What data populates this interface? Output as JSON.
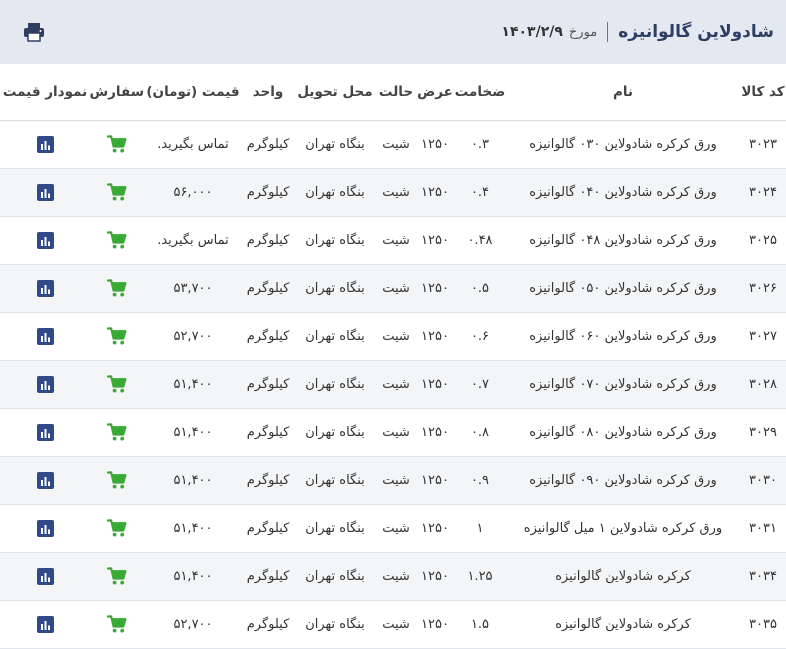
{
  "header": {
    "title": "شادولاین گالوانیزه",
    "date_label": "مورخ",
    "date_value": "۱۴۰۳/۲/۹",
    "print_icon": "printer-icon"
  },
  "colors": {
    "header_bg": "#e4e8f1",
    "title": "#2f3f63",
    "chart_button": "#2f4a86",
    "cart_icon": "#3aaa35"
  },
  "columns": {
    "code": "کد کالا",
    "name": "نام",
    "thickness": "ضخامت",
    "width": "عرض",
    "state": "حالت",
    "delivery": "محل تحویل",
    "unit": "واحد",
    "price": "قیمت (تومان)",
    "order": "سفارش",
    "chart": "نمودار قیمت"
  },
  "rows": [
    {
      "code": "۳۰۲۳",
      "name": "ورق کرکره شادولاین ۰۳۰ گالوانیزه",
      "thickness": "۰.۳",
      "width": "۱۲۵۰",
      "state": "شیت",
      "delivery": "بنگاه تهران",
      "unit": "کیلوگرم",
      "price": "تماس بگیرید."
    },
    {
      "code": "۳۰۲۴",
      "name": "ورق کرکره شادولاین ۰۴۰ گالوانیزه",
      "thickness": "۰.۴",
      "width": "۱۲۵۰",
      "state": "شیت",
      "delivery": "بنگاه تهران",
      "unit": "کیلوگرم",
      "price": "۵۶,۰۰۰"
    },
    {
      "code": "۳۰۲۵",
      "name": "ورق کرکره شادولاین ۰۴۸ گالوانیزه",
      "thickness": "۰.۴۸",
      "width": "۱۲۵۰",
      "state": "شیت",
      "delivery": "بنگاه تهران",
      "unit": "کیلوگرم",
      "price": "تماس بگیرید."
    },
    {
      "code": "۳۰۲۶",
      "name": "ورق کرکره شادولاین ۰۵۰ گالوانیزه",
      "thickness": "۰.۵",
      "width": "۱۲۵۰",
      "state": "شیت",
      "delivery": "بنگاه تهران",
      "unit": "کیلوگرم",
      "price": "۵۳,۷۰۰"
    },
    {
      "code": "۳۰۲۷",
      "name": "ورق کرکره شادولاین ۰۶۰ گالوانیزه",
      "thickness": "۰.۶",
      "width": "۱۲۵۰",
      "state": "شیت",
      "delivery": "بنگاه تهران",
      "unit": "کیلوگرم",
      "price": "۵۲,۷۰۰"
    },
    {
      "code": "۳۰۲۸",
      "name": "ورق کرکره شادولاین ۰۷۰ گالوانیزه",
      "thickness": "۰.۷",
      "width": "۱۲۵۰",
      "state": "شیت",
      "delivery": "بنگاه تهران",
      "unit": "کیلوگرم",
      "price": "۵۱,۴۰۰"
    },
    {
      "code": "۳۰۲۹",
      "name": "ورق کرکره شادولاین ۰۸۰ گالوانیزه",
      "thickness": "۰.۸",
      "width": "۱۲۵۰",
      "state": "شیت",
      "delivery": "بنگاه تهران",
      "unit": "کیلوگرم",
      "price": "۵۱,۴۰۰"
    },
    {
      "code": "۳۰۳۰",
      "name": "ورق کرکره شادولاین ۰۹۰ گالوانیزه",
      "thickness": "۰.۹",
      "width": "۱۲۵۰",
      "state": "شیت",
      "delivery": "بنگاه تهران",
      "unit": "کیلوگرم",
      "price": "۵۱,۴۰۰"
    },
    {
      "code": "۳۰۳۱",
      "name": "ورق کرکره شادولاین ۱ میل گالوانیزه",
      "thickness": "۱",
      "width": "۱۲۵۰",
      "state": "شیت",
      "delivery": "بنگاه تهران",
      "unit": "کیلوگرم",
      "price": "۵۱,۴۰۰"
    },
    {
      "code": "۳۰۳۴",
      "name": "کرکره شادولاین گالوانیزه",
      "thickness": "۱.۲۵",
      "width": "۱۲۵۰",
      "state": "شیت",
      "delivery": "بنگاه تهران",
      "unit": "کیلوگرم",
      "price": "۵۱,۴۰۰"
    },
    {
      "code": "۳۰۳۵",
      "name": "کرکره شادولاین گالوانیزه",
      "thickness": "۱.۵",
      "width": "۱۲۵۰",
      "state": "شیت",
      "delivery": "بنگاه تهران",
      "unit": "کیلوگرم",
      "price": "۵۲,۷۰۰"
    }
  ],
  "row_icons": {
    "order": "shopping-cart-icon",
    "chart": "bar-chart-icon"
  }
}
